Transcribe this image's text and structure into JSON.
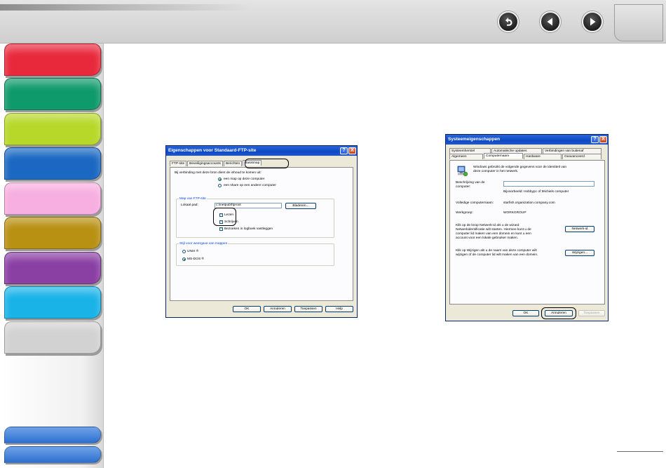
{
  "nav": {
    "back_icon": "return-arrow-icon",
    "prev_icon": "triangle-left-icon",
    "next_icon": "triangle-right-icon"
  },
  "sidebar": {
    "tabs": [
      {
        "color": "#e8293c"
      },
      {
        "color": "#0f9a6b"
      },
      {
        "color": "#b7d829"
      },
      {
        "color": "#1a68c2"
      },
      {
        "color": "#f7aee0"
      },
      {
        "color": "#b89012"
      },
      {
        "color": "#8a3fa3"
      },
      {
        "color": "#19b3e8"
      },
      {
        "color": "#d2d2d2"
      }
    ]
  },
  "ftp_dialog": {
    "title": "Eigenschappen voor Standaard-FTP-site",
    "help_label": "?",
    "close_label": "X",
    "tabs": [
      "FTP-site",
      "Beveiligingsaccounts",
      "Berichten",
      "Basismap"
    ],
    "intro": "Bij verbinding met deze bron dient de inhoud te komen uit:",
    "radio_local": "een map op deze computer",
    "radio_share": "een share op een andere computer",
    "group_folder_label": "Map van FTP-site",
    "local_path_label": "Lokaal pad:",
    "local_path_value": "c:\\inetpub\\ftproot",
    "browse_label": "Bladeren...",
    "read_label": "Lezen",
    "write_label": "Schrijven",
    "log_label": "Bezoeken in logboek vastleggen",
    "group_style_label": "Stijl voor weergave van mappen",
    "unix_label": "UNIX ®",
    "msdos_label": "MS-DOS ®",
    "ok_label": "OK",
    "cancel_label": "Annuleren",
    "apply_label": "Toepassen",
    "help_button_label": "Help"
  },
  "sys_dialog": {
    "title": "Systeemeigenschappen",
    "help_label": "?",
    "close_label": "X",
    "tabs_row1": [
      "Systeemherstel",
      "Automatische updates",
      "Verbindingen van buitenaf"
    ],
    "tabs_row2": [
      "Algemeen",
      "Computernaam",
      "Hardware",
      "Geavanceerd"
    ],
    "info_text_1": "Windows gebruikt de volgende gegevens voor de identiteit van",
    "info_text_2": "deze computer in het netwerk.",
    "desc_label_1": "Beschrijving van de",
    "desc_label_2": "computer:",
    "desc_value": "",
    "example_text": "Bijvoorbeeld: Hobbypc of Michiels computer",
    "fullname_label": "Volledige computernaam:",
    "fullname_value": "starfish.organization.company.com",
    "workgroup_label": "Werkgroep:",
    "workgroup_value": "WORKGROUP",
    "netid_text_1": "Klik op de knop Netwerk-id als u de wizard",
    "netid_text_2": "Netwerkidentificatie wilt starten. Hiermee kunt u de",
    "netid_text_3": "computer lid maken van een domein en kunt u een",
    "netid_text_4": "account voor een lokale gebruiker maken.",
    "netid_button": "Netwerk-id",
    "change_text_1": "Klik op Wijzigen als u de naam van deze computer wilt",
    "change_text_2": "wijzigen of de computer lid wilt maken van een domein.",
    "change_button": "Wijzigen...",
    "ok_label": "OK",
    "cancel_label": "Annuleren",
    "apply_label": "Toepassen"
  }
}
